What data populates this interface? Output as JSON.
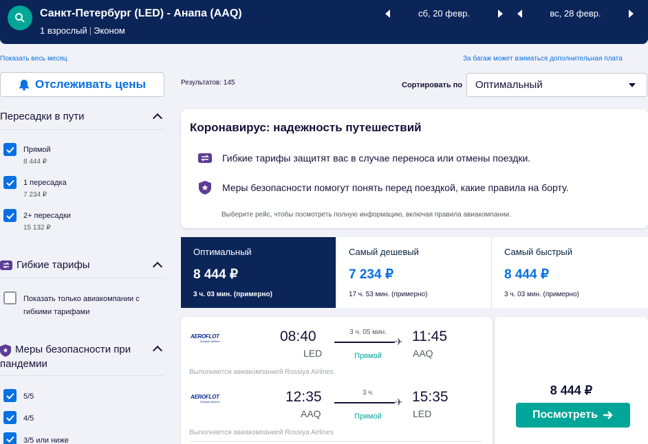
{
  "header": {
    "route": "Санкт-Петербург (LED) - Анапа (AAQ)",
    "passengers": "1 взрослый",
    "cabin": "Эконом",
    "depart_date": "сб, 20 февр.",
    "return_date": "вс, 28 февр.",
    "icons": {
      "search": "search-icon",
      "prev": "triangle-left-icon",
      "next": "triangle-right-icon"
    }
  },
  "links": {
    "show_month": "Показать весь месяц",
    "baggage_note": "За багаж может взиматься дополнительная плата"
  },
  "track_prices": {
    "label": "Отслеживать цены",
    "icon": "bell-icon"
  },
  "filters": {
    "stops": {
      "title": "Пересадки в пути",
      "options": [
        {
          "label": "Прямой",
          "price": "8 444 ₽",
          "checked": true
        },
        {
          "label": "1 пересадка",
          "price": "7 234 ₽",
          "checked": true
        },
        {
          "label": "2+ пересадки",
          "price": "15 132 ₽",
          "checked": true
        }
      ]
    },
    "flexible": {
      "title": "Гибкие тарифы",
      "option_line1": "Показать только авиакомпании с",
      "option_line2": "гибкими тарифами",
      "checked": false
    },
    "safety": {
      "title_line1": "Меры безопасности при",
      "title_line2": "пандемии",
      "options": [
        "5/5",
        "4/5",
        "3/5 или ниже"
      ]
    }
  },
  "results": {
    "count_text": "Результатов: 145",
    "sort_label": "Сортировать по",
    "sort_value": "Оптимальный"
  },
  "covid": {
    "title": "Коронавирус: надежность путешествий",
    "item1": "Гибкие тарифы защитят вас в случае переноса или отмены поездки.",
    "item2": "Меры безопасности помогут понять перед поездкой, какие правила на борту.",
    "note": "Выберите рейс, чтобы посмотреть полную информацию, включая правила авиакомпании."
  },
  "tabs": [
    {
      "name": "Оптимальный",
      "price": "8 444 ₽",
      "duration": "3 ч. 03 мин. (примерно)",
      "active": true
    },
    {
      "name": "Самый дешевый",
      "price": "7 234 ₽",
      "duration": "17 ч. 53 мин. (примерно)",
      "active": false
    },
    {
      "name": "Самый быстрый",
      "price": "8 444 ₽",
      "duration": "3 ч. 03 мин. (примерно)",
      "active": false
    }
  ],
  "flight": {
    "airline_logo": "AEROFLOT",
    "airline_logo_sub": "Russian Airlines",
    "legs": [
      {
        "depart_time": "08:40",
        "depart_airport": "LED",
        "duration": "3 ч. 05 мин.",
        "stops": "Прямой",
        "arrive_time": "11:45",
        "arrive_airport": "AAQ",
        "operated_by": "Выполняется авиакомпанией Rossiya Airlines"
      },
      {
        "depart_time": "12:35",
        "depart_airport": "AAQ",
        "duration": "3 ч.",
        "stops": "Прямой",
        "arrive_time": "15:35",
        "arrive_airport": "LED",
        "operated_by": "Выполняется авиакомпанией Rossiya Airlines"
      }
    ],
    "price": "8 444 ₽",
    "view_button": "Посмотреть"
  },
  "colors": {
    "navy": "#0b2559",
    "blue": "#0770e3",
    "teal": "#00a698",
    "purple": "#5c3c96"
  }
}
